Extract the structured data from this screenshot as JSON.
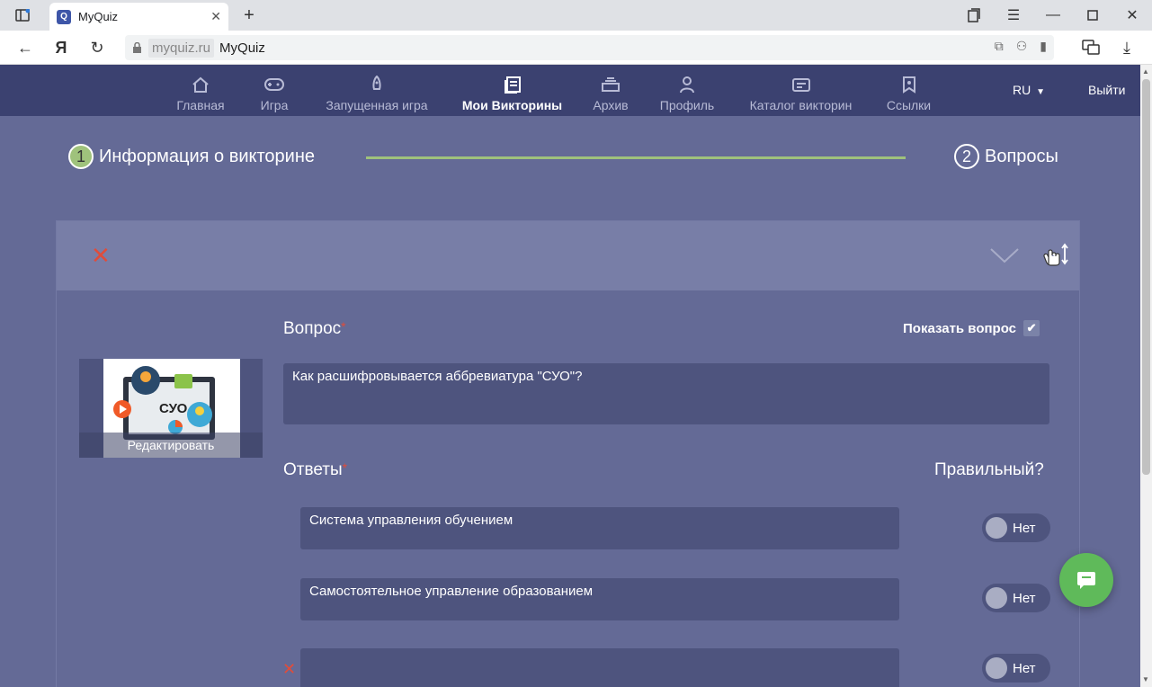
{
  "browser": {
    "tab_title": "MyQuiz",
    "favicon_letter": "Q",
    "domain": "myquiz.ru",
    "page_title": "MyQuiz",
    "icons": [
      "sidebar-icon",
      "new-tab-icon",
      "bookmarks-icon",
      "menu-icon",
      "minimize-icon",
      "maximize-icon",
      "close-icon"
    ]
  },
  "nav": {
    "items": [
      {
        "label": "Главная",
        "icon": "home-icon"
      },
      {
        "label": "Игра",
        "icon": "gamepad-icon"
      },
      {
        "label": "Запущенная игра",
        "icon": "rocket-icon"
      },
      {
        "label": "Мои Викторины",
        "icon": "quizzes-icon"
      },
      {
        "label": "Архив",
        "icon": "archive-icon"
      },
      {
        "label": "Профиль",
        "icon": "user-icon"
      },
      {
        "label": "Каталог викторин",
        "icon": "catalog-icon"
      },
      {
        "label": "Ссылки",
        "icon": "bookmark-icon"
      }
    ],
    "active": "Мои Викторины",
    "lang": "RU",
    "logout": "Выйти"
  },
  "steps": [
    {
      "num": "1",
      "label": "Информация о викторине",
      "done": true
    },
    {
      "num": "2",
      "label": "Вопросы",
      "done": false
    }
  ],
  "question": {
    "label": "Вопрос",
    "required_mark": "*",
    "show_question_label": "Показать вопрос",
    "show_question_checked": true,
    "text": "Как расшифровывается аббревиатура \"СУО\"?",
    "thumbnail_text": "СУО",
    "edit_label": "Редактировать"
  },
  "answers": {
    "label": "Ответы",
    "required_mark": "*",
    "correct_label": "Правильный?",
    "items": [
      {
        "text": "Система управления обучением",
        "correct": "Нет"
      },
      {
        "text": "Самостоятельное управление образованием",
        "correct": "Нет"
      },
      {
        "text": "",
        "correct": "Нет"
      }
    ]
  },
  "colors": {
    "accent_green": "#9fc27c",
    "delete_red": "#e04c3a",
    "header_bg": "#3b4170",
    "page_bg": "#646a96",
    "chat_green": "#5fba5a"
  }
}
